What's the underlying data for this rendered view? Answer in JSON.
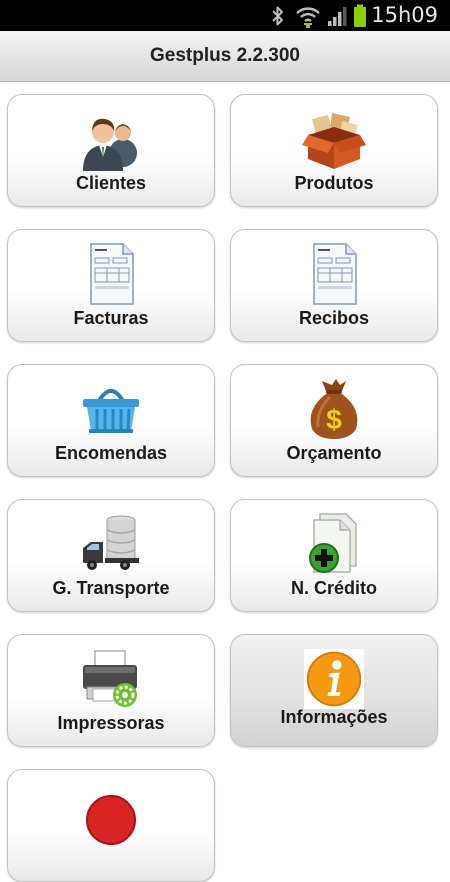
{
  "status_bar": {
    "time": "15h09",
    "icons": [
      "bluetooth-icon",
      "wifi-icon",
      "signal-icon",
      "battery-icon"
    ]
  },
  "app": {
    "title": "Gestplus 2.2.300"
  },
  "menu": {
    "items": [
      {
        "label": "Clientes",
        "icon": "clients-icon"
      },
      {
        "label": "Produtos",
        "icon": "products-box-icon"
      },
      {
        "label": "Facturas",
        "icon": "invoice-document-icon"
      },
      {
        "label": "Recibos",
        "icon": "receipt-document-icon"
      },
      {
        "label": "Encomendas",
        "icon": "basket-icon"
      },
      {
        "label": "Orçamento",
        "icon": "money-bag-icon"
      },
      {
        "label": "G. Transporte",
        "icon": "truck-icon"
      },
      {
        "label": "N. Crédito",
        "icon": "credit-note-add-icon"
      },
      {
        "label": "Impressoras",
        "icon": "printer-settings-icon"
      },
      {
        "label": "Informações",
        "icon": "info-icon"
      }
    ]
  },
  "colors": {
    "status_bar": "#000000",
    "battery": "#8bd100",
    "info_orange": "#f39a12",
    "money_bag": "#a0521c",
    "plus_green": "#3aa435"
  }
}
